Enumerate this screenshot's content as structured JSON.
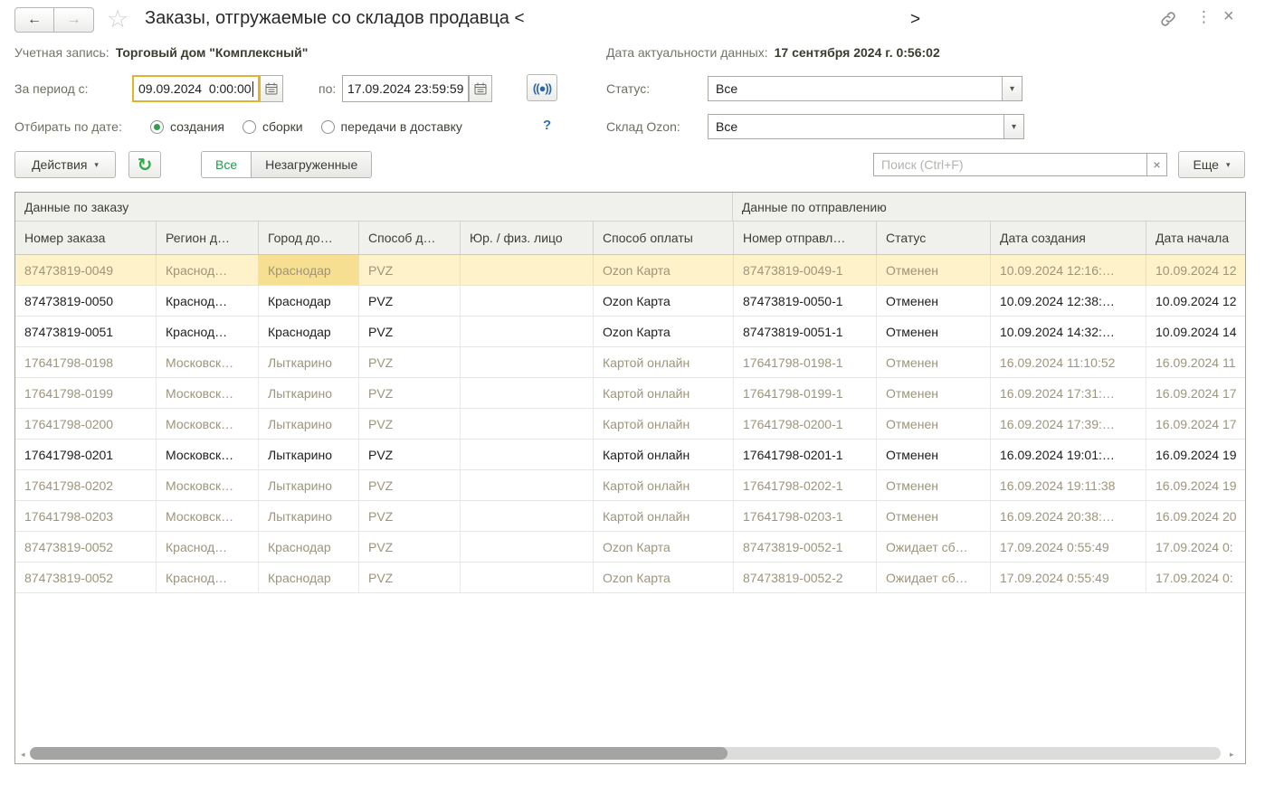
{
  "window": {
    "title": "Заказы, отгружаемые со складов продавца",
    "title_marker_left": "<",
    "title_marker_right": ">"
  },
  "icons": {
    "back": "←",
    "forward": "→",
    "star": "☆",
    "more": "⋮",
    "close": "×",
    "dropdown_arrow": "▾",
    "refresh": "↻",
    "period_select": "((●))",
    "search_clear": "×",
    "help": "?",
    "hscroll_left": "◂",
    "hscroll_right": "▸"
  },
  "account": {
    "label": "Учетная запись:",
    "value": "Торговый дом \"Комплексный\""
  },
  "actuality": {
    "label": "Дата актуальности данных:",
    "value": "17 сентября 2024 г. 0:56:02"
  },
  "filters": {
    "period": {
      "label": "За период с:",
      "from": "09.09.2024  0:00:00",
      "to_label": "по:",
      "to": "17.09.2024 23:59:59"
    },
    "status": {
      "label": "Статус:",
      "value": "Все"
    },
    "date_filter": {
      "label": "Отбирать по дате:",
      "options": [
        {
          "label": "создания",
          "selected": true
        },
        {
          "label": "сборки",
          "selected": false
        },
        {
          "label": "передачи в доставку",
          "selected": false
        }
      ],
      "help": "?"
    },
    "warehouse": {
      "label": "Склад Ozon:",
      "value": "Все"
    }
  },
  "toolbar": {
    "actions_label": "Действия",
    "segments": [
      {
        "label": "Все",
        "selected": true
      },
      {
        "label": "Незагруженные",
        "selected": false
      }
    ],
    "search_placeholder": "Поиск (Ctrl+F)",
    "more_label": "Еще"
  },
  "table": {
    "group_headers": [
      "Данные по заказу",
      "Данные по отправлению"
    ],
    "columns": [
      "Номер заказа",
      "Регион д…",
      "Город до…",
      "Способ д…",
      "Юр. / физ. лицо",
      "Способ оплаты",
      "Номер отправл…",
      "Статус",
      "Дата создания",
      "Дата начала"
    ],
    "rows": [
      {
        "cells": [
          "87473819-0049",
          "Краснод…",
          "Краснодар",
          "PVZ",
          "",
          "Ozon Карта",
          "87473819-0049-1",
          "Отменен",
          "10.09.2024 12:16:…",
          "10.09.2024 12"
        ],
        "dim": true,
        "selected": true,
        "current_cell": 2
      },
      {
        "cells": [
          "87473819-0050",
          "Краснод…",
          "Краснодар",
          "PVZ",
          "",
          "Ozon Карта",
          "87473819-0050-1",
          "Отменен",
          "10.09.2024 12:38:…",
          "10.09.2024 12"
        ],
        "dim": false,
        "selected": false
      },
      {
        "cells": [
          "87473819-0051",
          "Краснод…",
          "Краснодар",
          "PVZ",
          "",
          "Ozon Карта",
          "87473819-0051-1",
          "Отменен",
          "10.09.2024 14:32:…",
          "10.09.2024 14"
        ],
        "dim": false,
        "selected": false
      },
      {
        "cells": [
          "17641798-0198",
          "Московск…",
          "Лыткарино",
          "PVZ",
          "",
          "Картой онлайн",
          "17641798-0198-1",
          "Отменен",
          "16.09.2024 11:10:52",
          "16.09.2024 11"
        ],
        "dim": true,
        "selected": false
      },
      {
        "cells": [
          "17641798-0199",
          "Московск…",
          "Лыткарино",
          "PVZ",
          "",
          "Картой онлайн",
          "17641798-0199-1",
          "Отменен",
          "16.09.2024 17:31:…",
          "16.09.2024 17"
        ],
        "dim": true,
        "selected": false
      },
      {
        "cells": [
          "17641798-0200",
          "Московск…",
          "Лыткарино",
          "PVZ",
          "",
          "Картой онлайн",
          "17641798-0200-1",
          "Отменен",
          "16.09.2024 17:39:…",
          "16.09.2024 17"
        ],
        "dim": true,
        "selected": false
      },
      {
        "cells": [
          "17641798-0201",
          "Московск…",
          "Лыткарино",
          "PVZ",
          "",
          "Картой онлайн",
          "17641798-0201-1",
          "Отменен",
          "16.09.2024 19:01:…",
          "16.09.2024 19"
        ],
        "dim": false,
        "selected": false
      },
      {
        "cells": [
          "17641798-0202",
          "Московск…",
          "Лыткарино",
          "PVZ",
          "",
          "Картой онлайн",
          "17641798-0202-1",
          "Отменен",
          "16.09.2024 19:11:38",
          "16.09.2024 19"
        ],
        "dim": true,
        "selected": false
      },
      {
        "cells": [
          "17641798-0203",
          "Московск…",
          "Лыткарино",
          "PVZ",
          "",
          "Картой онлайн",
          "17641798-0203-1",
          "Отменен",
          "16.09.2024 20:38:…",
          "16.09.2024 20"
        ],
        "dim": true,
        "selected": false
      },
      {
        "cells": [
          "87473819-0052",
          "Краснод…",
          "Краснодар",
          "PVZ",
          "",
          "Ozon Карта",
          "87473819-0052-1",
          "Ожидает сб…",
          "17.09.2024 0:55:49",
          "17.09.2024 0:"
        ],
        "dim": true,
        "selected": false
      },
      {
        "cells": [
          "87473819-0052",
          "Краснод…",
          "Краснодар",
          "PVZ",
          "",
          "Ozon Карта",
          "87473819-0052-2",
          "Ожидает сб…",
          "17.09.2024 0:55:49",
          "17.09.2024 0:"
        ],
        "dim": true,
        "selected": false
      }
    ]
  }
}
